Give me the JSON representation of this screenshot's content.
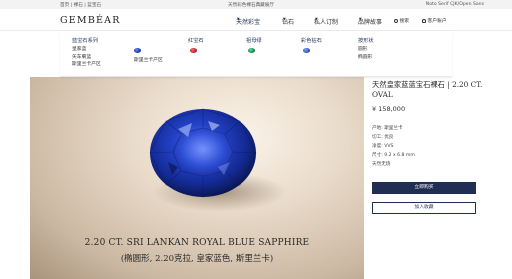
{
  "topbar": {
    "breadcrumb": "首页 | 裸石 | 蓝宝石",
    "promo": "天然彩色裸石典藏展厅",
    "font_note": "Noto Serif CJK/Open Sans"
  },
  "header": {
    "logo": "GEMBÉAR",
    "nav": [
      {
        "label": "天然彩宝",
        "active": true
      },
      {
        "label": "钻石",
        "active": false
      },
      {
        "label": "私人订制",
        "active": false
      },
      {
        "label": "品牌故事",
        "active": false
      }
    ],
    "search_label": "搜索",
    "account_label": "客户账户"
  },
  "mega_menu": {
    "sapphire": {
      "title": "蓝宝石系列",
      "items": [
        "皇家蓝",
        "矢车菊蓝",
        "斯里兰卡产区"
      ],
      "gem_label": "斯里兰卡产区",
      "gem_color": "#1a3aa8"
    },
    "ruby": {
      "title": "红宝石",
      "gem_color": "#c21d2b"
    },
    "emerald": {
      "title": "祖母绿",
      "gem_color": "#11894b"
    },
    "fancy_diamond": {
      "title": "彩色钻石",
      "gem_color": "#2f4fb8"
    },
    "shapes": {
      "title": "按形状",
      "items": [
        "圆形",
        "椭圆形"
      ]
    }
  },
  "hero": {
    "caption_line1": "2.20 CT. SRI LANKAN ROYAL BLUE SAPPHIRE",
    "caption_line2": "(椭圆形, 2.20克拉, 皇家蓝色, 斯里兰卡)"
  },
  "product": {
    "title": "天然皇家蓝蓝宝石裸石 | 2.20 CT. OVAL",
    "price": "¥ 158,000",
    "specs": [
      "产地: 斯里兰卡",
      "切工: 优良",
      "净度: VVS",
      "尺寸: 9.2 x 6.8 mm",
      "天然无烧"
    ],
    "buy_label": "立即购买",
    "wishlist_label": "加入收藏",
    "accent_color": "#1f2e52"
  }
}
